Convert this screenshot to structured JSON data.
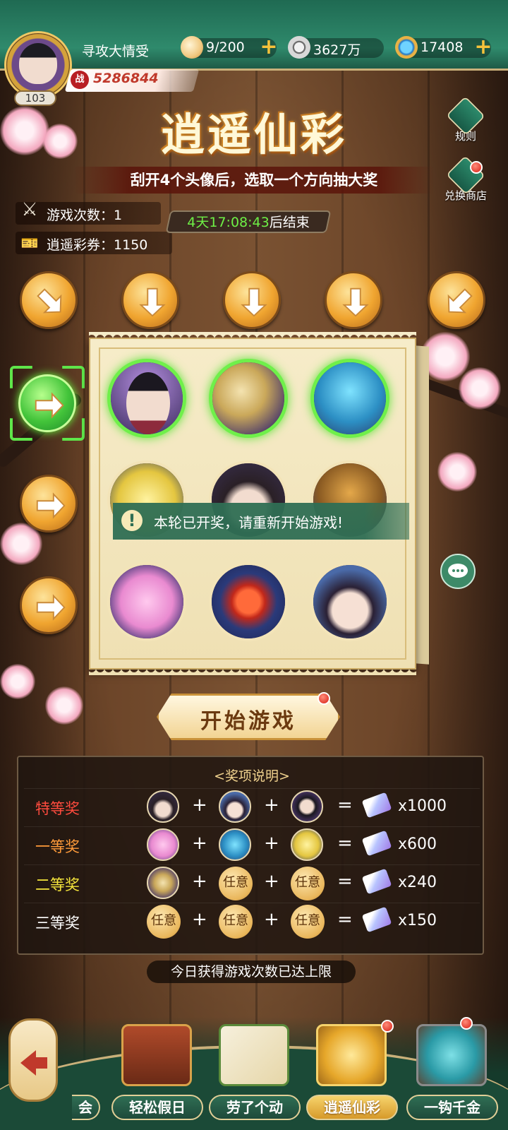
{
  "player": {
    "name": "寻攻大情受",
    "level": "103",
    "power_icon": "战",
    "power": "5286844"
  },
  "resources": [
    {
      "name": "stamina",
      "value": "9/200",
      "icon": "steamed-bun-icon"
    },
    {
      "name": "silver",
      "value": "3627万",
      "icon": "silver-coin-icon"
    },
    {
      "name": "jade",
      "value": "17408",
      "icon": "jade-icon"
    }
  ],
  "event": {
    "title": "逍遥仙彩",
    "subtitle": "刮开4个头像后，选取一个方向抽大奖",
    "rules_label": "规则",
    "shop_label": "兑换商店",
    "play_count_label": "游戏次数：",
    "play_count": "1",
    "tickets_label": "逍遥彩券：",
    "tickets": "1150",
    "timer_value": "4天17:08:43",
    "timer_suffix": "后结束",
    "notice": "本轮已开奖，请重新开始游戏!",
    "start_button": "开始游戏",
    "daily_limit": "今日获得游戏次数已达上限"
  },
  "board": {
    "cells": [
      {
        "name": "purple-lady-avatar",
        "selected": true
      },
      {
        "name": "golden-dragon-avatar",
        "selected": true
      },
      {
        "name": "blue-spirit-avatar",
        "selected": true
      },
      {
        "name": "yellow-sprout-avatar",
        "selected": false
      },
      {
        "name": "swordsman-avatar",
        "selected": false
      },
      {
        "name": "broom-spirit-avatar",
        "selected": false
      },
      {
        "name": "pink-spirit-avatar",
        "selected": false
      },
      {
        "name": "red-lantern-avatar",
        "selected": false
      },
      {
        "name": "maiden-avatar",
        "selected": false
      }
    ]
  },
  "prizes": {
    "title": "<奖项说明>",
    "rows": [
      {
        "name": "特等奖",
        "color": "#ff4b3e",
        "combo": [
          "swordsman",
          "maiden",
          "purple-lady"
        ],
        "multiplier": "x1000"
      },
      {
        "name": "一等奖",
        "color": "#ff9b3a",
        "combo": [
          "pink-spirit",
          "blue-spirit",
          "yellow-sprout"
        ],
        "multiplier": "x600"
      },
      {
        "name": "二等奖",
        "color": "#f5e53c",
        "combo": [
          "golden-dragon",
          "任意",
          "任意"
        ],
        "multiplier": "x240"
      },
      {
        "name": "三等奖",
        "color": "#ffffff",
        "combo": [
          "任意",
          "任意",
          "任意"
        ],
        "multiplier": "x150"
      }
    ],
    "plus": "+",
    "equals": "="
  },
  "nav": {
    "partial_label": "会",
    "items": [
      "轻松假日",
      "劳了个动",
      "逍遥仙彩",
      "一钩千金"
    ],
    "active": "逍遥仙彩"
  },
  "colors": {
    "accent_green": "#2f8a6c",
    "gold": "#f0a530",
    "selected_glow": "#6ff04a"
  }
}
